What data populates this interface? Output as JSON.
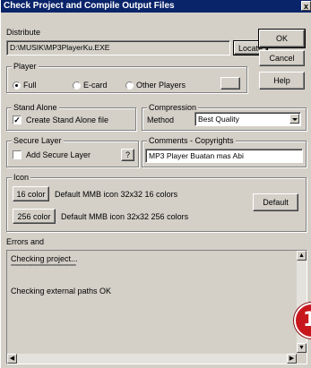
{
  "window": {
    "title": "Check Project and Compile Output Files",
    "close_glyph": "x"
  },
  "distribute": {
    "label": "Distribute",
    "path": "D:\\MUSIK\\MP3PlayerKu.EXE",
    "locate_label": "Locate"
  },
  "buttons": {
    "ok": "OK",
    "cancel": "Cancel",
    "help": "Help",
    "default_icon": "Default"
  },
  "player": {
    "group_title": "Player",
    "options": [
      {
        "label": "Full",
        "selected": true
      },
      {
        "label": "E-card",
        "selected": false
      },
      {
        "label": "Other Players",
        "selected": false
      }
    ],
    "browse_label": ""
  },
  "standalone": {
    "group_title": "Stand Alone",
    "checkbox_label": "Create Stand Alone file",
    "checked": true
  },
  "compression": {
    "group_title": "Compression",
    "method_label": "Method",
    "method_value": "Best Quality"
  },
  "secure_layer": {
    "group_title": "Secure Layer",
    "checkbox_label": "Add Secure Layer",
    "checked": false,
    "help_glyph": "?"
  },
  "comments": {
    "group_title": "Comments - Copyrights",
    "value": "MP3 Player Buatan mas Abi"
  },
  "icon": {
    "group_title": "Icon",
    "rows": [
      {
        "button": "16 color",
        "desc": "Default MMB icon 32x32 16 colors"
      },
      {
        "button": "256 color",
        "desc": "Default MMB icon 32x32 256 colors"
      }
    ]
  },
  "errors": {
    "label": "Errors and",
    "lines": [
      "Checking project...",
      "==============================",
      "Checking external paths OK"
    ]
  },
  "badge": {
    "text": "1",
    "color": "#c8161d"
  },
  "colors": {
    "titlebar": "#0a246a",
    "face": "#d4d0c8"
  }
}
